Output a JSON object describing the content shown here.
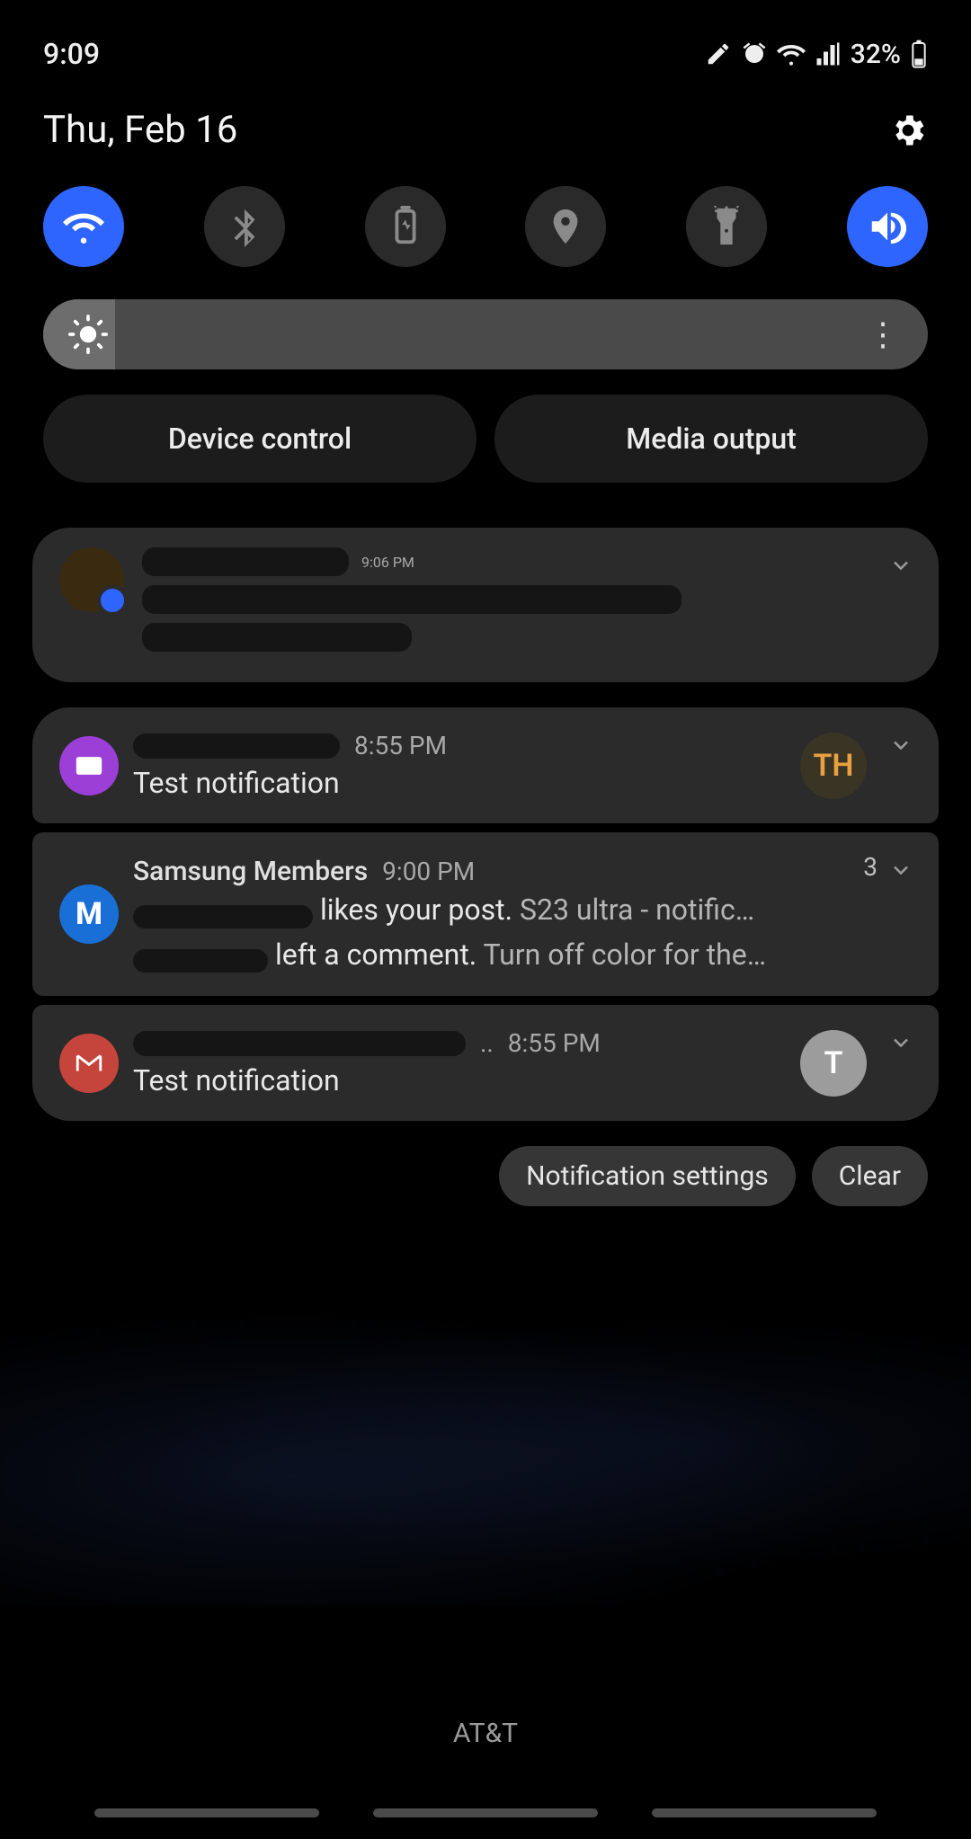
{
  "status": {
    "time": "9:09",
    "battery": "32%"
  },
  "date": "Thu, Feb 16",
  "qs": {
    "wifi_on": true,
    "sound_on": true
  },
  "panels": {
    "device": "Device control",
    "media": "Media output"
  },
  "notifs": {
    "conv": {
      "time": "9:06 PM"
    },
    "mail": {
      "time": "8:55 PM",
      "body": "Test notification",
      "avatar": "TH"
    },
    "members": {
      "app": "Samsung Members",
      "time": "9:00 PM",
      "count": "3",
      "l1a": "likes your post.",
      "l1b": "S23 ultra - notific…",
      "l2a": "left a comment.",
      "l2b": "Turn off color for the…"
    },
    "gmail": {
      "time": "8:55 PM",
      "body": "Test notification",
      "avatar": "T"
    }
  },
  "footer": {
    "settings": "Notification settings",
    "clear": "Clear"
  },
  "carrier": "AT&T"
}
